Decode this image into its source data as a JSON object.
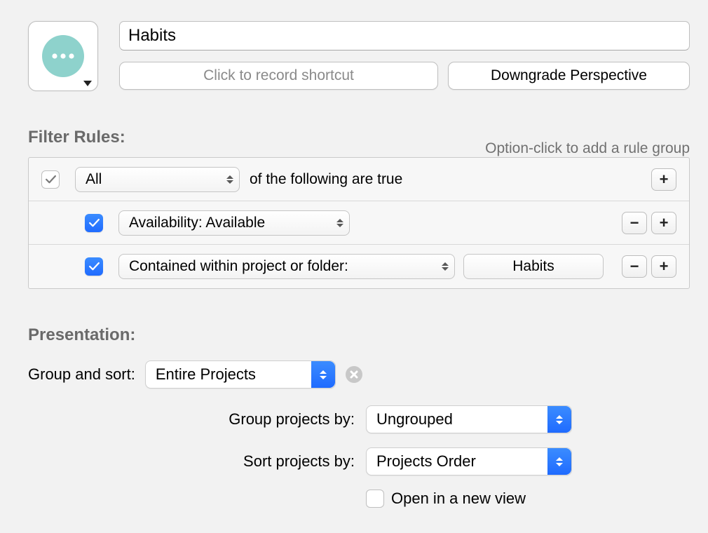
{
  "header": {
    "name_value": "Habits",
    "shortcut_placeholder": "Click to record shortcut",
    "downgrade_label": "Downgrade Perspective"
  },
  "filter": {
    "heading": "Filter Rules:",
    "hint": "Option-click to add a rule group",
    "group": {
      "operator": "All",
      "suffix": "of the following are true"
    },
    "rules": [
      {
        "label": "Availability: Available"
      },
      {
        "label": "Contained within project or folder:",
        "token": "Habits"
      }
    ]
  },
  "presentation": {
    "heading": "Presentation:",
    "group_sort_label": "Group and sort:",
    "group_sort_value": "Entire Projects",
    "group_by_label": "Group projects by:",
    "group_by_value": "Ungrouped",
    "sort_by_label": "Sort projects by:",
    "sort_by_value": "Projects Order",
    "open_new_view_label": "Open in a new view"
  },
  "icons": {
    "plus": "+",
    "minus": "−"
  }
}
